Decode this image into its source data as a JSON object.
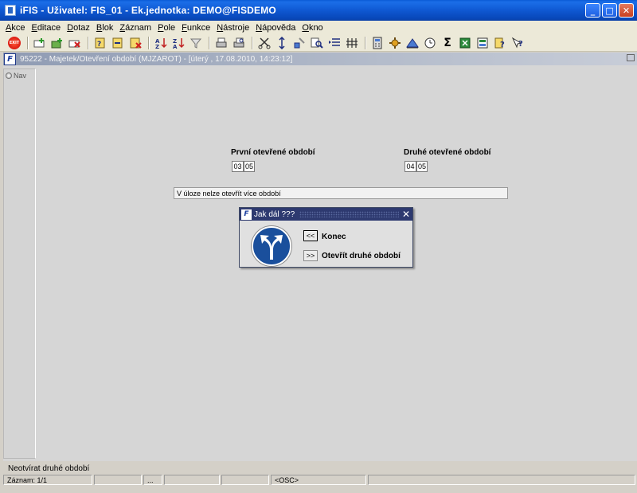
{
  "window": {
    "title": "iFIS - Uživatel: FIS_01 - Ek.jednotka: DEMO@FISDEMO",
    "minimize_label": "_",
    "maximize_label": "□",
    "close_label": "✕"
  },
  "menu": [
    {
      "key": "A",
      "rest": "kce"
    },
    {
      "key": "E",
      "rest": "ditace"
    },
    {
      "key": "D",
      "rest": "otaz"
    },
    {
      "key": "B",
      "rest": "lok"
    },
    {
      "key": "Z",
      "rest": "áznam"
    },
    {
      "key": "P",
      "rest": "ole"
    },
    {
      "key": "F",
      "rest": "unkce"
    },
    {
      "key": "N",
      "rest": "ástroje"
    },
    {
      "key": "N",
      "rest": "ápověda"
    },
    {
      "key": "O",
      "rest": "kno"
    }
  ],
  "toolbar": {
    "exit_label": "EXIT",
    "sigma_label": "Σ",
    "help_label": "?"
  },
  "inner_window": {
    "title": "95222 - Majetek/Otevření období (MJZAROT) - [úterý , 17.08.2010, 14:23:12]",
    "logo": "F"
  },
  "nav": {
    "label": "Nav"
  },
  "form": {
    "first_period_label": "První otevřené období",
    "first_period_a": "03",
    "first_period_b": "05",
    "second_period_label": "Druhé otevřené období",
    "second_period_a": "04",
    "second_period_b": "05",
    "message": "V úloze nelze otevřít více období"
  },
  "dialog": {
    "title": "Jak dál ???",
    "close_label": "✕",
    "logo": "F",
    "option1_btn": "<<",
    "option1_label": "Konec",
    "option2_btn": ">>",
    "option2_label": "Otevřít druhé období"
  },
  "status": {
    "message": "Neotvírat druhé období",
    "record": "Záznam: 1/1",
    "cell2": "",
    "cell3": "...",
    "cell4": "",
    "mode": "<OSC>"
  }
}
